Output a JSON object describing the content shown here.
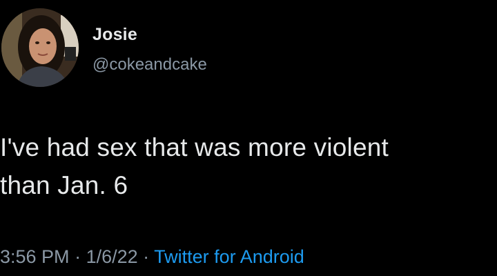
{
  "tweet": {
    "author": {
      "display_name": "Josie",
      "handle": "@cokeandcake",
      "avatar_icon": "profile-photo"
    },
    "text_line_1": "I've had sex that was more violent",
    "text_line_2": "than Jan. 6",
    "meta": {
      "time": "3:56 PM",
      "separator": " · ",
      "date": "1/6/22",
      "source": "Twitter for Android"
    }
  },
  "colors": {
    "background": "#000000",
    "primary_text": "#e7e9ea",
    "secondary_text": "#8b98a5",
    "link": "#1d9bf0"
  }
}
